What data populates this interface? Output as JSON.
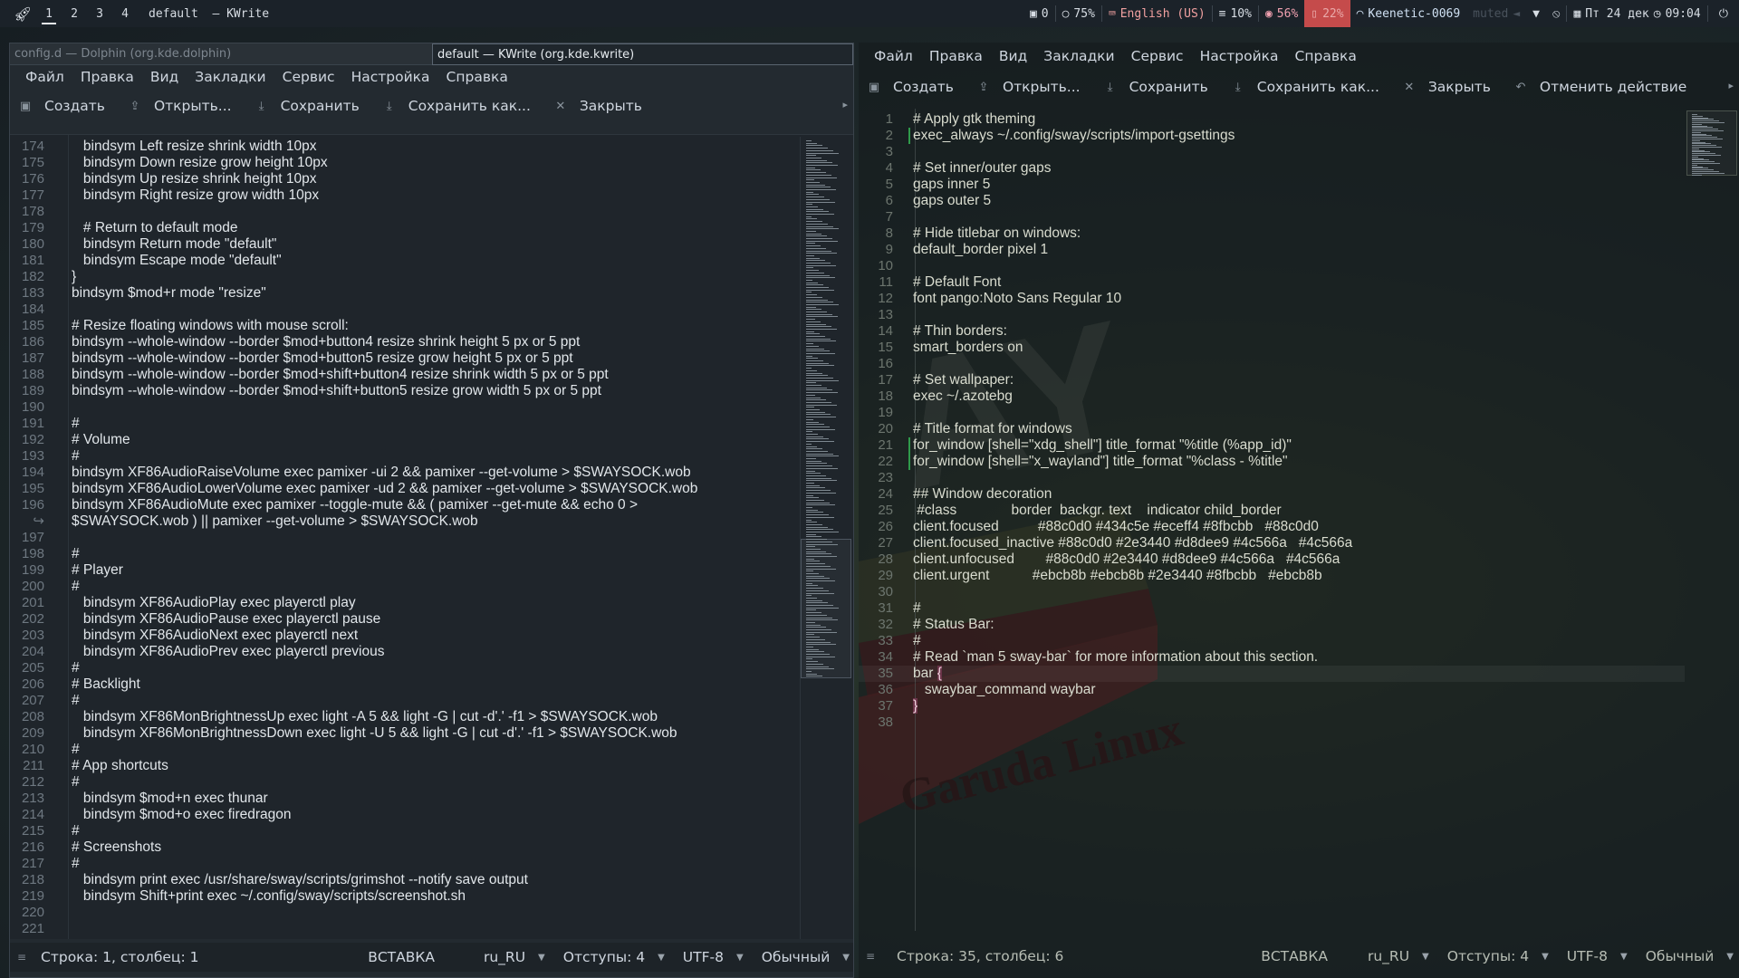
{
  "topbar": {
    "launcher_icon": "rocket-icon",
    "workspaces": [
      "1",
      "2",
      "3",
      "4"
    ],
    "active_workspace": "1",
    "title": "default  — KWrite",
    "status": {
      "windows": "0",
      "cpu": "75%",
      "keyboard": "English (US)",
      "memory": "10%",
      "disk": "56%",
      "battery": "22%",
      "wifi": "Keenetic-0069",
      "muted": "muted",
      "date": "Пт 24 дек",
      "time": "09:04"
    }
  },
  "left_window": {
    "tab_inactive": "config.d — Dolphin (org.kde.dolphin)",
    "tab_active": "default  — KWrite (org.kde.kwrite)",
    "menu": [
      "Файл",
      "Правка",
      "Вид",
      "Закладки",
      "Сервис",
      "Настройка",
      "Справка"
    ],
    "toolbar": {
      "new": "Создать",
      "open": "Открыть...",
      "save": "Сохранить",
      "save_as": "Сохранить как...",
      "close": "Закрыть"
    },
    "lines": [
      {
        "n": "174",
        "t": "   bindsym Left resize shrink width 10px"
      },
      {
        "n": "175",
        "t": "   bindsym Down resize grow height 10px"
      },
      {
        "n": "176",
        "t": "   bindsym Up resize shrink height 10px"
      },
      {
        "n": "177",
        "t": "   bindsym Right resize grow width 10px"
      },
      {
        "n": "178",
        "t": ""
      },
      {
        "n": "179",
        "t": "   # Return to default mode"
      },
      {
        "n": "180",
        "t": "   bindsym Return mode \"default\""
      },
      {
        "n": "181",
        "t": "   bindsym Escape mode \"default\""
      },
      {
        "n": "182",
        "t": "}"
      },
      {
        "n": "183",
        "t": "bindsym $mod+r mode \"resize\""
      },
      {
        "n": "184",
        "t": ""
      },
      {
        "n": "185",
        "t": "# Resize floating windows with mouse scroll:"
      },
      {
        "n": "186",
        "t": "bindsym --whole-window --border $mod+button4 resize shrink height 5 px or 5 ppt"
      },
      {
        "n": "187",
        "t": "bindsym --whole-window --border $mod+button5 resize grow height 5 px or 5 ppt"
      },
      {
        "n": "188",
        "t": "bindsym --whole-window --border $mod+shift+button4 resize shrink width 5 px or 5 ppt"
      },
      {
        "n": "189",
        "t": "bindsym --whole-window --border $mod+shift+button5 resize grow width 5 px or 5 ppt"
      },
      {
        "n": "190",
        "t": ""
      },
      {
        "n": "191",
        "t": "#"
      },
      {
        "n": "192",
        "t": "# Volume"
      },
      {
        "n": "193",
        "t": "#"
      },
      {
        "n": "194",
        "t": "bindsym XF86AudioRaiseVolume exec pamixer -ui 2 && pamixer --get-volume > $SWAYSOCK.wob"
      },
      {
        "n": "195",
        "t": "bindsym XF86AudioLowerVolume exec pamixer -ud 2 && pamixer --get-volume > $SWAYSOCK.wob"
      },
      {
        "n": "196",
        "t": "bindsym XF86AudioMute exec pamixer --toggle-mute && ( pamixer --get-mute && echo 0 >"
      },
      {
        "n": "↪",
        "t": "$SWAYSOCK.wob ) || pamixer --get-volume > $SWAYSOCK.wob"
      },
      {
        "n": "197",
        "t": ""
      },
      {
        "n": "198",
        "t": "#"
      },
      {
        "n": "199",
        "t": "# Player"
      },
      {
        "n": "200",
        "t": "#"
      },
      {
        "n": "201",
        "t": "   bindsym XF86AudioPlay exec playerctl play"
      },
      {
        "n": "202",
        "t": "   bindsym XF86AudioPause exec playerctl pause"
      },
      {
        "n": "203",
        "t": "   bindsym XF86AudioNext exec playerctl next"
      },
      {
        "n": "204",
        "t": "   bindsym XF86AudioPrev exec playerctl previous"
      },
      {
        "n": "205",
        "t": "#"
      },
      {
        "n": "206",
        "t": "# Backlight"
      },
      {
        "n": "207",
        "t": "#"
      },
      {
        "n": "208",
        "t": "   bindsym XF86MonBrightnessUp exec light -A 5 && light -G | cut -d'.' -f1 > $SWAYSOCK.wob"
      },
      {
        "n": "209",
        "t": "   bindsym XF86MonBrightnessDown exec light -U 5 && light -G | cut -d'.' -f1 > $SWAYSOCK.wob"
      },
      {
        "n": "210",
        "t": "#"
      },
      {
        "n": "211",
        "t": "# App shortcuts"
      },
      {
        "n": "212",
        "t": "#"
      },
      {
        "n": "213",
        "t": "   bindsym $mod+n exec thunar"
      },
      {
        "n": "214",
        "t": "   bindsym $mod+o exec firedragon"
      },
      {
        "n": "215",
        "t": "#"
      },
      {
        "n": "216",
        "t": "# Screenshots"
      },
      {
        "n": "217",
        "t": "#"
      },
      {
        "n": "218",
        "t": "   bindsym print exec /usr/share/sway/scripts/grimshot --notify save output"
      },
      {
        "n": "219",
        "t": "   bindsym Shift+print exec ~/.config/sway/scripts/screenshot.sh"
      },
      {
        "n": "220",
        "t": ""
      },
      {
        "n": "221",
        "t": ""
      }
    ],
    "status": {
      "position": "Строка: 1, столбец: 1",
      "mode": "ВСТАВКА",
      "lang": "ru_RU",
      "indent": "Отступы: 4",
      "encoding": "UTF-8",
      "syntax": "Обычный"
    }
  },
  "right_window": {
    "menu": [
      "Файл",
      "Правка",
      "Вид",
      "Закладки",
      "Сервис",
      "Настройка",
      "Справка"
    ],
    "toolbar": {
      "new": "Создать",
      "open": "Открыть...",
      "save": "Сохранить",
      "save_as": "Сохранить как...",
      "close": "Закрыть",
      "undo": "Отменить действие"
    },
    "lines": [
      {
        "n": "1",
        "t": "# Apply gtk theming"
      },
      {
        "n": "2",
        "t": "exec_always ~/.config/sway/scripts/import-gsettings"
      },
      {
        "n": "3",
        "t": ""
      },
      {
        "n": "4",
        "t": "# Set inner/outer gaps"
      },
      {
        "n": "5",
        "t": "gaps inner 5"
      },
      {
        "n": "6",
        "t": "gaps outer 5"
      },
      {
        "n": "7",
        "t": ""
      },
      {
        "n": "8",
        "t": "# Hide titlebar on windows:"
      },
      {
        "n": "9",
        "t": "default_border pixel 1"
      },
      {
        "n": "10",
        "t": ""
      },
      {
        "n": "11",
        "t": "# Default Font"
      },
      {
        "n": "12",
        "t": "font pango:Noto Sans Regular 10"
      },
      {
        "n": "13",
        "t": ""
      },
      {
        "n": "14",
        "t": "# Thin borders:"
      },
      {
        "n": "15",
        "t": "smart_borders on"
      },
      {
        "n": "16",
        "t": ""
      },
      {
        "n": "17",
        "t": "# Set wallpaper:"
      },
      {
        "n": "18",
        "t": "exec ~/.azotebg"
      },
      {
        "n": "19",
        "t": ""
      },
      {
        "n": "20",
        "t": "# Title format for windows"
      },
      {
        "n": "21",
        "t": "for_window [shell=\"xdg_shell\"] title_format \"%title (%app_id)\""
      },
      {
        "n": "22",
        "t": "for_window [shell=\"x_wayland\"] title_format \"%class - %title\""
      },
      {
        "n": "23",
        "t": ""
      },
      {
        "n": "24",
        "t": "## Window decoration"
      },
      {
        "n": "25",
        "t": " #class              border  backgr. text    indicator child_border"
      },
      {
        "n": "26",
        "t": "client.focused          #88c0d0 #434c5e #eceff4 #8fbcbb   #88c0d0"
      },
      {
        "n": "27",
        "t": "client.focused_inactive #88c0d0 #2e3440 #d8dee9 #4c566a   #4c566a"
      },
      {
        "n": "28",
        "t": "client.unfocused        #88c0d0 #2e3440 #d8dee9 #4c566a   #4c566a"
      },
      {
        "n": "29",
        "t": "client.urgent           #ebcb8b #ebcb8b #2e3440 #8fbcbb   #ebcb8b"
      },
      {
        "n": "30",
        "t": ""
      },
      {
        "n": "31",
        "t": "#"
      },
      {
        "n": "32",
        "t": "# Status Bar:"
      },
      {
        "n": "33",
        "t": "#"
      },
      {
        "n": "34",
        "t": "# Read `man 5 sway-bar` for more information about this section."
      },
      {
        "n": "35",
        "t": "bar {"
      },
      {
        "n": "36",
        "t": "   swaybar_command waybar"
      },
      {
        "n": "37",
        "t": "}"
      },
      {
        "n": "38",
        "t": ""
      }
    ],
    "status": {
      "position": "Строка: 35, столбец: 6",
      "mode": "ВСТАВКА",
      "lang": "ru_RU",
      "indent": "Отступы: 4",
      "encoding": "UTF-8",
      "syntax": "Обычный"
    },
    "wallpaper_text": "Garuda Linux"
  }
}
